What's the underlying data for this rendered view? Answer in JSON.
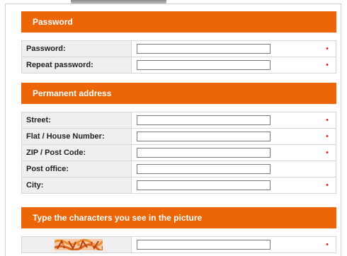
{
  "sections": {
    "password": {
      "title": "Password"
    },
    "address": {
      "title": "Permanent address"
    },
    "captcha": {
      "title": "Type the characters you see in the picture"
    }
  },
  "password_rows": [
    {
      "label": "Password:",
      "value": "",
      "required": "•"
    },
    {
      "label": "Repeat password:",
      "value": "",
      "required": "•"
    }
  ],
  "address_rows": [
    {
      "label": "Street:",
      "value": "",
      "required": "•"
    },
    {
      "label": "Flat / House Number:",
      "value": "",
      "required": "•"
    },
    {
      "label": "ZIP / Post Code:",
      "value": "",
      "required": "•"
    },
    {
      "label": "Post office:",
      "value": "",
      "required": ""
    },
    {
      "label": "City:",
      "value": "",
      "required": "•"
    }
  ],
  "captcha_row": {
    "value": "",
    "required": "•"
  },
  "colors": {
    "header_bg": "#ec6608",
    "label_bg": "#efefef",
    "required_marker": "#e02020"
  }
}
